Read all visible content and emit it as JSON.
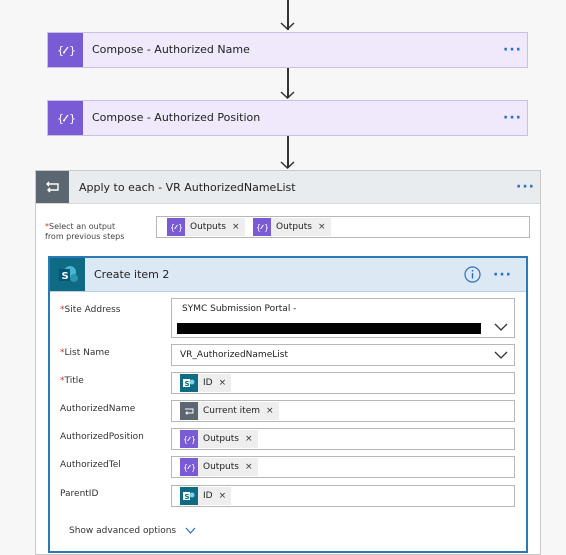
{
  "compose_name": {
    "title": "Compose - Authorized Name"
  },
  "compose_position": {
    "title": "Compose - Authorized Position"
  },
  "apply_each": {
    "title": "Apply to each - VR AuthorizedNameList",
    "select_label_line1": "Select an output",
    "select_label_line2": "from previous steps",
    "required_mark": "*",
    "outputs_tokens": [
      "Outputs",
      "Outputs"
    ]
  },
  "create_item": {
    "title": "Create item 2",
    "fields": {
      "site_address": {
        "label": "Site Address",
        "required": "*",
        "value": "SYMC Submission Portal -"
      },
      "list_name": {
        "label": "List Name",
        "required": "*",
        "value": "VR_AuthorizedNameList"
      },
      "title": {
        "label": "Title",
        "required": "*",
        "token": "ID"
      },
      "authorized_name": {
        "label": "AuthorizedName",
        "token": "Current item"
      },
      "authorized_position": {
        "label": "AuthorizedPosition",
        "token": "Outputs"
      },
      "authorized_tel": {
        "label": "AuthorizedTel",
        "token": "Outputs"
      },
      "parent_id": {
        "label": "ParentID",
        "token": "ID"
      }
    },
    "show_advanced": "Show advanced options"
  },
  "token_remove_glyph": "×",
  "colors": {
    "compose_accent": "#7a5bd6",
    "loop_accent": "#5b6670",
    "sharepoint_accent": "#0f6a83",
    "link_blue": "#2b6fc4"
  }
}
